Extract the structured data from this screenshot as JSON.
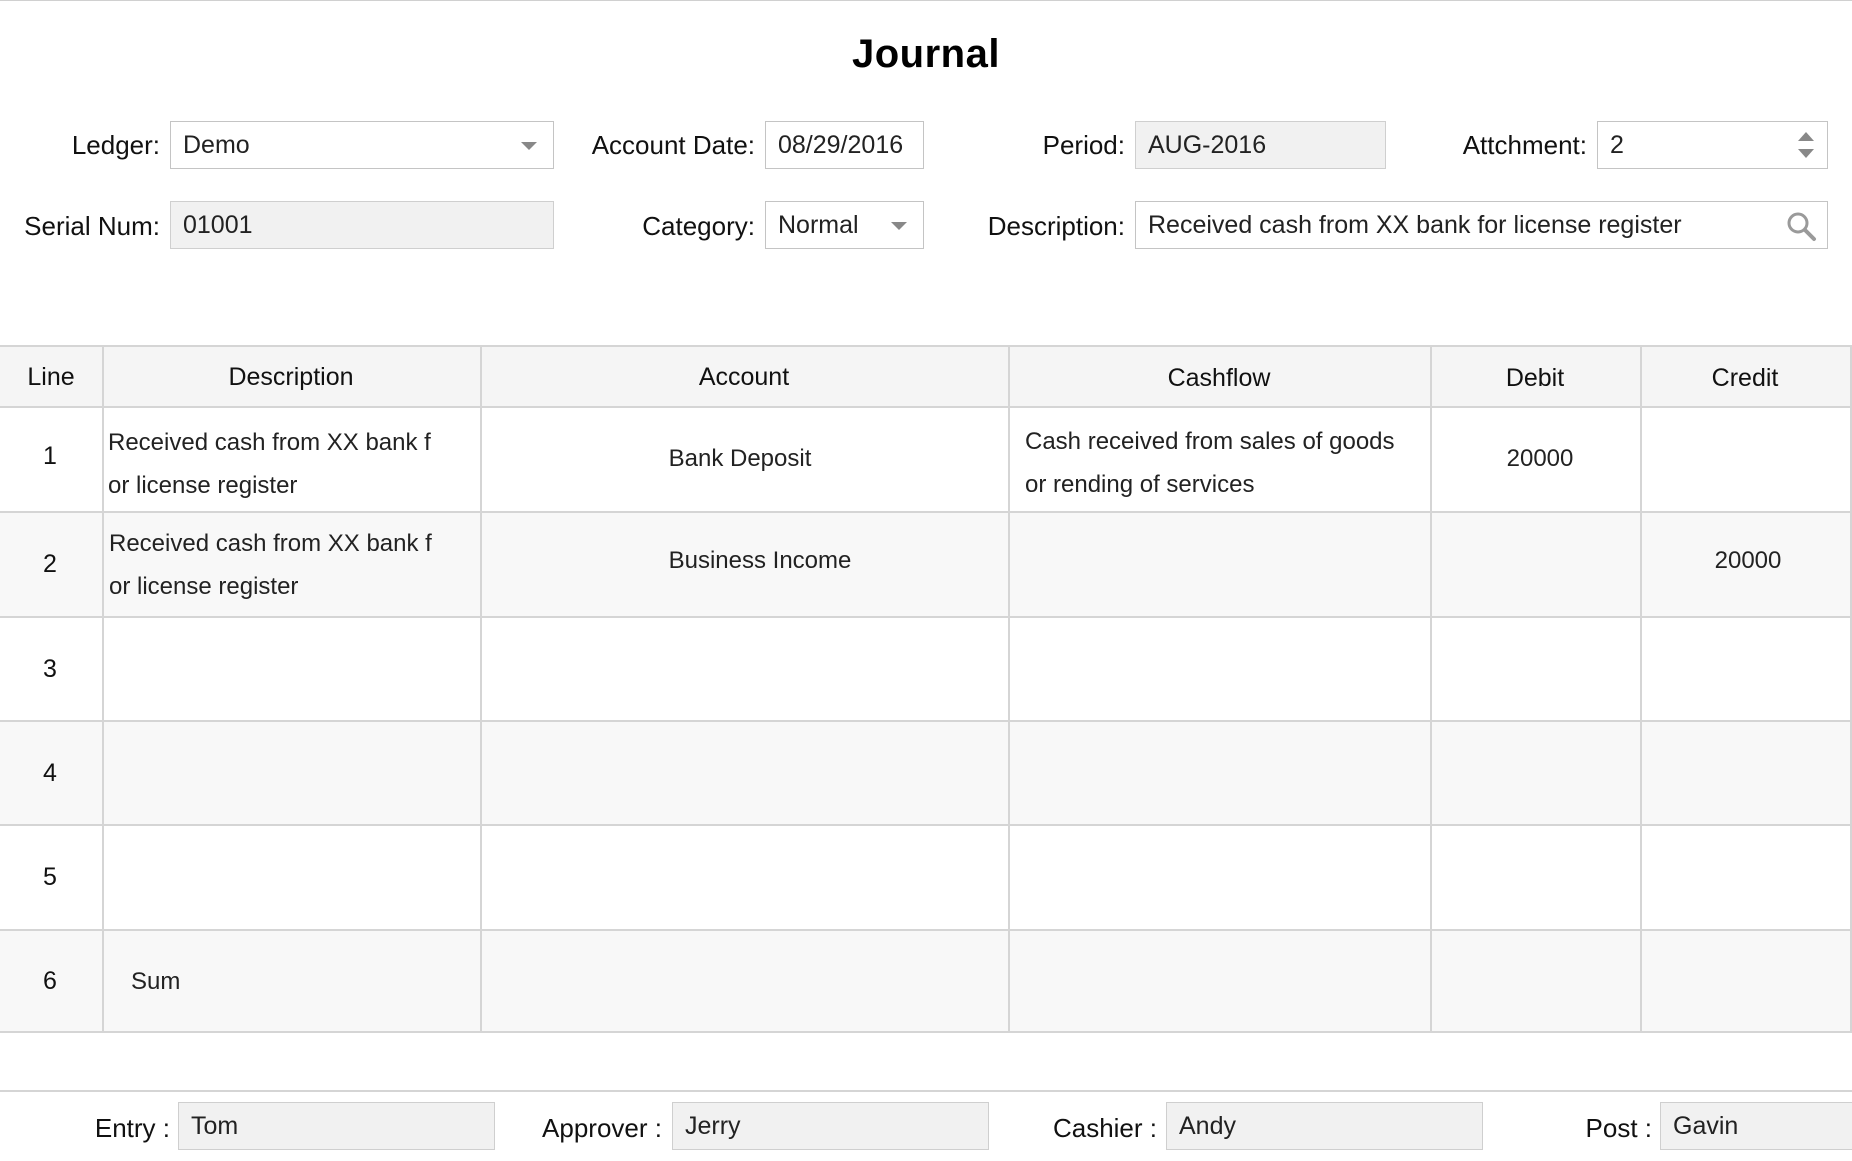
{
  "title": "Journal",
  "form": {
    "ledger_label": "Ledger:",
    "ledger_value": "Demo",
    "account_date_label": "Account Date:",
    "account_date_value": "08/29/2016",
    "period_label": "Period:",
    "period_value": "AUG-2016",
    "attachment_label": "Attchment:",
    "attachment_value": "2",
    "serial_label": "Serial Num:",
    "serial_value": "01001",
    "category_label": "Category:",
    "category_value": "Normal",
    "description_label": "Description:",
    "description_value": "Received cash from XX bank for license register",
    "icons": {
      "ledger_dropdown": "chevron-down-icon",
      "category_dropdown": "chevron-down-icon",
      "attachment_spinner": "stepper-icon",
      "description_search": "search-icon"
    }
  },
  "table": {
    "headers": {
      "line": "Line",
      "description": "Description",
      "account": "Account",
      "cashflow": "Cashflow",
      "debit": "Debit",
      "credit": "Credit"
    },
    "rows": [
      {
        "line": "1",
        "description": "Received cash from XX bank f or license register",
        "description_l1": "Received cash from XX bank f",
        "description_l2": "or license register",
        "account": "Bank Deposit",
        "cashflow_l1": "Cash received from sales of goods",
        "cashflow_l2": "or rending of services",
        "debit": "20000",
        "credit": ""
      },
      {
        "line": "2",
        "description_l1": "Received cash from XX bank f",
        "description_l2": "or license register",
        "account": "Business Income",
        "cashflow_l1": "",
        "cashflow_l2": "",
        "debit": "",
        "credit": "20000"
      },
      {
        "line": "3",
        "description_l1": "",
        "description_l2": "",
        "account": "",
        "cashflow_l1": "",
        "cashflow_l2": "",
        "debit": "",
        "credit": ""
      },
      {
        "line": "4",
        "description_l1": "",
        "description_l2": "",
        "account": "",
        "cashflow_l1": "",
        "cashflow_l2": "",
        "debit": "",
        "credit": ""
      },
      {
        "line": "5",
        "description_l1": "",
        "description_l2": "",
        "account": "",
        "cashflow_l1": "",
        "cashflow_l2": "",
        "debit": "",
        "credit": ""
      },
      {
        "line": "6",
        "description_l1": "Sum",
        "description_l2": "",
        "account": "",
        "cashflow_l1": "",
        "cashflow_l2": "",
        "debit": "",
        "credit": ""
      }
    ]
  },
  "footer": {
    "entry_label": "Entry :",
    "entry_value": "Tom",
    "approver_label": "Approver :",
    "approver_value": "Jerry",
    "cashier_label": "Cashier :",
    "cashier_value": "Andy",
    "post_label": "Post :",
    "post_value": "Gavin"
  },
  "colors": {
    "border": "#c4c4c4",
    "readonly_bg": "#f1f1f1",
    "header_bg": "#f5f5f5",
    "alt_row_bg": "#f8f8f8",
    "grid_line": "#d5d5d5"
  }
}
